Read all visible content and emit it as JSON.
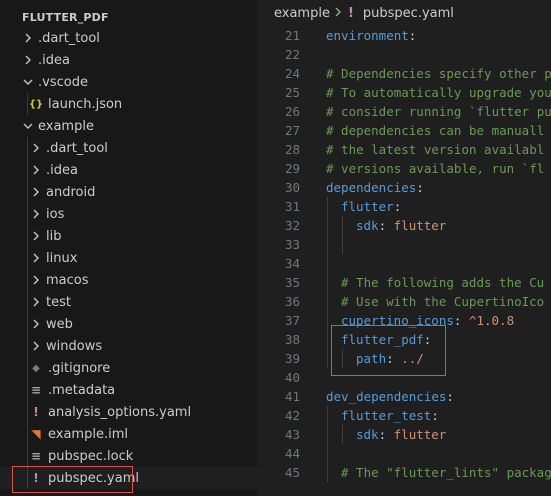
{
  "explorer": {
    "title": "FLUTTER_PDF",
    "items": [
      {
        "label": ".dart_tool",
        "kind": "folder",
        "expanded": false,
        "depth": 0
      },
      {
        "label": ".idea",
        "kind": "folder",
        "expanded": false,
        "depth": 0
      },
      {
        "label": ".vscode",
        "kind": "folder",
        "expanded": true,
        "depth": 0
      },
      {
        "label": "launch.json",
        "kind": "json",
        "depth": 1
      },
      {
        "label": "example",
        "kind": "folder",
        "expanded": true,
        "depth": 0
      },
      {
        "label": ".dart_tool",
        "kind": "folder",
        "expanded": false,
        "depth": 1
      },
      {
        "label": ".idea",
        "kind": "folder",
        "expanded": false,
        "depth": 1
      },
      {
        "label": "android",
        "kind": "folder",
        "expanded": false,
        "depth": 1
      },
      {
        "label": "ios",
        "kind": "folder",
        "expanded": false,
        "depth": 1
      },
      {
        "label": "lib",
        "kind": "folder",
        "expanded": false,
        "depth": 1
      },
      {
        "label": "linux",
        "kind": "folder",
        "expanded": false,
        "depth": 1
      },
      {
        "label": "macos",
        "kind": "folder",
        "expanded": false,
        "depth": 1
      },
      {
        "label": "test",
        "kind": "folder",
        "expanded": false,
        "depth": 1
      },
      {
        "label": "web",
        "kind": "folder",
        "expanded": false,
        "depth": 1
      },
      {
        "label": "windows",
        "kind": "folder",
        "expanded": false,
        "depth": 1
      },
      {
        "label": ".gitignore",
        "kind": "git",
        "depth": 1
      },
      {
        "label": ".metadata",
        "kind": "text",
        "depth": 1
      },
      {
        "label": "analysis_options.yaml",
        "kind": "yaml",
        "depth": 1
      },
      {
        "label": "example.iml",
        "kind": "rss",
        "depth": 1
      },
      {
        "label": "pubspec.lock",
        "kind": "text",
        "depth": 1
      },
      {
        "label": "pubspec.yaml",
        "kind": "yaml",
        "depth": 1,
        "selected": true
      }
    ]
  },
  "breadcrumb": {
    "folder": "example",
    "file": "pubspec.yaml"
  },
  "icons": {
    "json": "{}",
    "yaml": "!",
    "text": "≡",
    "git": "◆",
    "rss": "◥"
  },
  "colors": {
    "yaml": "#c586c0",
    "json": "#cbcb41",
    "text": "#9da5b4",
    "git": "#6d8086",
    "rss": "#e37933",
    "annotation": "#d9534f"
  },
  "code": [
    {
      "num": "21",
      "indent": 0,
      "tokens": [
        {
          "t": "environment",
          "c": "k"
        },
        {
          "t": ":",
          "c": "p"
        }
      ]
    },
    {
      "num": "22",
      "indent": 0,
      "tokens": []
    },
    {
      "num": "24",
      "indent": 0,
      "tokens": [
        {
          "t": "# Dependencies specify other p",
          "c": "c"
        }
      ]
    },
    {
      "num": "25",
      "indent": 0,
      "tokens": [
        {
          "t": "# To automatically upgrade you",
          "c": "c"
        }
      ]
    },
    {
      "num": "26",
      "indent": 0,
      "tokens": [
        {
          "t": "# consider running `flutter pu",
          "c": "c"
        }
      ]
    },
    {
      "num": "27",
      "indent": 0,
      "tokens": [
        {
          "t": "# dependencies can be manuall",
          "c": "c"
        }
      ]
    },
    {
      "num": "28",
      "indent": 0,
      "tokens": [
        {
          "t": "# the latest version availabl",
          "c": "c"
        }
      ]
    },
    {
      "num": "29",
      "indent": 0,
      "tokens": [
        {
          "t": "# versions available, run `fl",
          "c": "c"
        }
      ]
    },
    {
      "num": "30",
      "indent": 0,
      "tokens": [
        {
          "t": "dependencies",
          "c": "k"
        },
        {
          "t": ":",
          "c": "p"
        }
      ]
    },
    {
      "num": "31",
      "indent": 1,
      "tokens": [
        {
          "t": "flutter",
          "c": "k"
        },
        {
          "t": ":",
          "c": "p"
        }
      ]
    },
    {
      "num": "32",
      "indent": 2,
      "tokens": [
        {
          "t": "sdk",
          "c": "k"
        },
        {
          "t": ": ",
          "c": "p"
        },
        {
          "t": "flutter",
          "c": "s"
        }
      ]
    },
    {
      "num": "33",
      "indent": 2,
      "tokens": []
    },
    {
      "num": "34",
      "indent": 1,
      "tokens": []
    },
    {
      "num": "35",
      "indent": 1,
      "tokens": [
        {
          "t": "# The following adds the Cu",
          "c": "c"
        }
      ]
    },
    {
      "num": "36",
      "indent": 1,
      "tokens": [
        {
          "t": "# Use with the CupertinoIco",
          "c": "c"
        }
      ]
    },
    {
      "num": "37",
      "indent": 1,
      "tokens": [
        {
          "t": "cupertino_icons",
          "c": "k"
        },
        {
          "t": ": ",
          "c": "p"
        },
        {
          "t": "^1.0.8",
          "c": "s"
        }
      ]
    },
    {
      "num": "38",
      "indent": 1,
      "tokens": [
        {
          "t": "flutter_pdf",
          "c": "k"
        },
        {
          "t": ":",
          "c": "p"
        }
      ]
    },
    {
      "num": "39",
      "indent": 2,
      "tokens": [
        {
          "t": "path",
          "c": "k"
        },
        {
          "t": ": ",
          "c": "p"
        },
        {
          "t": "../",
          "c": "s"
        }
      ]
    },
    {
      "num": "40",
      "indent": 0,
      "tokens": []
    },
    {
      "num": "41",
      "indent": 0,
      "tokens": [
        {
          "t": "dev_dependencies",
          "c": "k"
        },
        {
          "t": ":",
          "c": "p"
        }
      ]
    },
    {
      "num": "42",
      "indent": 1,
      "tokens": [
        {
          "t": "flutter_test",
          "c": "k"
        },
        {
          "t": ":",
          "c": "p"
        }
      ]
    },
    {
      "num": "43",
      "indent": 2,
      "tokens": [
        {
          "t": "sdk",
          "c": "k"
        },
        {
          "t": ": ",
          "c": "p"
        },
        {
          "t": "flutter",
          "c": "s"
        }
      ]
    },
    {
      "num": "44",
      "indent": 1,
      "tokens": []
    },
    {
      "num": "45",
      "indent": 1,
      "tokens": [
        {
          "t": "# The \"flutter_lints\" packag",
          "c": "c"
        }
      ]
    }
  ]
}
